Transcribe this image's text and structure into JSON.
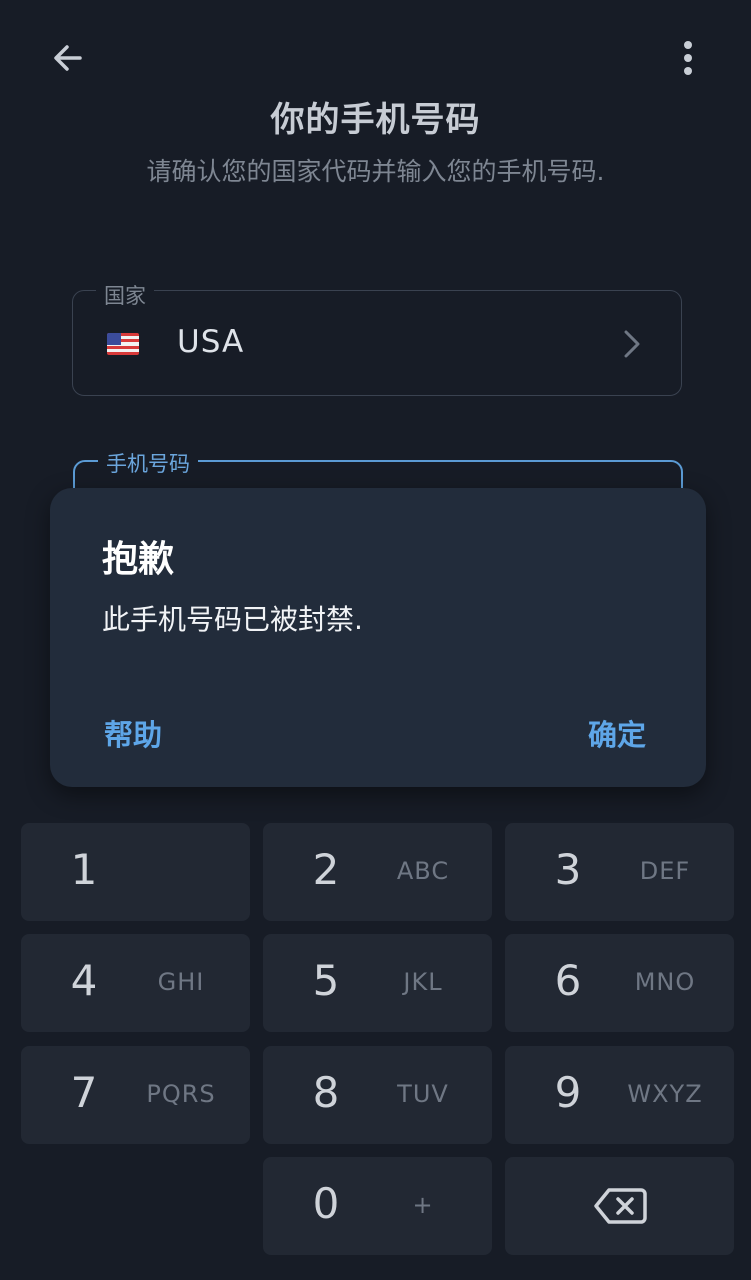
{
  "header": {
    "back_icon": "arrow-left-icon",
    "menu_icon": "more-vertical-icon",
    "title": "你的手机号码",
    "subtitle": "请确认您的国家代码并输入您的手机号码."
  },
  "country_field": {
    "legend": "国家",
    "flag_icon": "us-flag-icon",
    "value": "USA",
    "chevron_icon": "chevron-right-icon"
  },
  "phone_field": {
    "legend": "手机号码"
  },
  "dialog": {
    "title": "抱歉",
    "message": "此手机号码已被封禁.",
    "help_label": "帮助",
    "ok_label": "确定"
  },
  "keypad": {
    "keys": [
      {
        "digit": "1",
        "letters": ""
      },
      {
        "digit": "2",
        "letters": "ABC"
      },
      {
        "digit": "3",
        "letters": "DEF"
      },
      {
        "digit": "4",
        "letters": "GHI"
      },
      {
        "digit": "5",
        "letters": "JKL"
      },
      {
        "digit": "6",
        "letters": "MNO"
      },
      {
        "digit": "7",
        "letters": "PQRS"
      },
      {
        "digit": "8",
        "letters": "TUV"
      },
      {
        "digit": "9",
        "letters": "WXYZ"
      },
      {
        "digit": "0",
        "letters": "+"
      }
    ],
    "backspace_icon": "backspace-icon"
  },
  "colors": {
    "background": "#171c26",
    "dialog_bg": "#222c3b",
    "accent": "#5ea6e8",
    "key_bg": "#222833"
  }
}
